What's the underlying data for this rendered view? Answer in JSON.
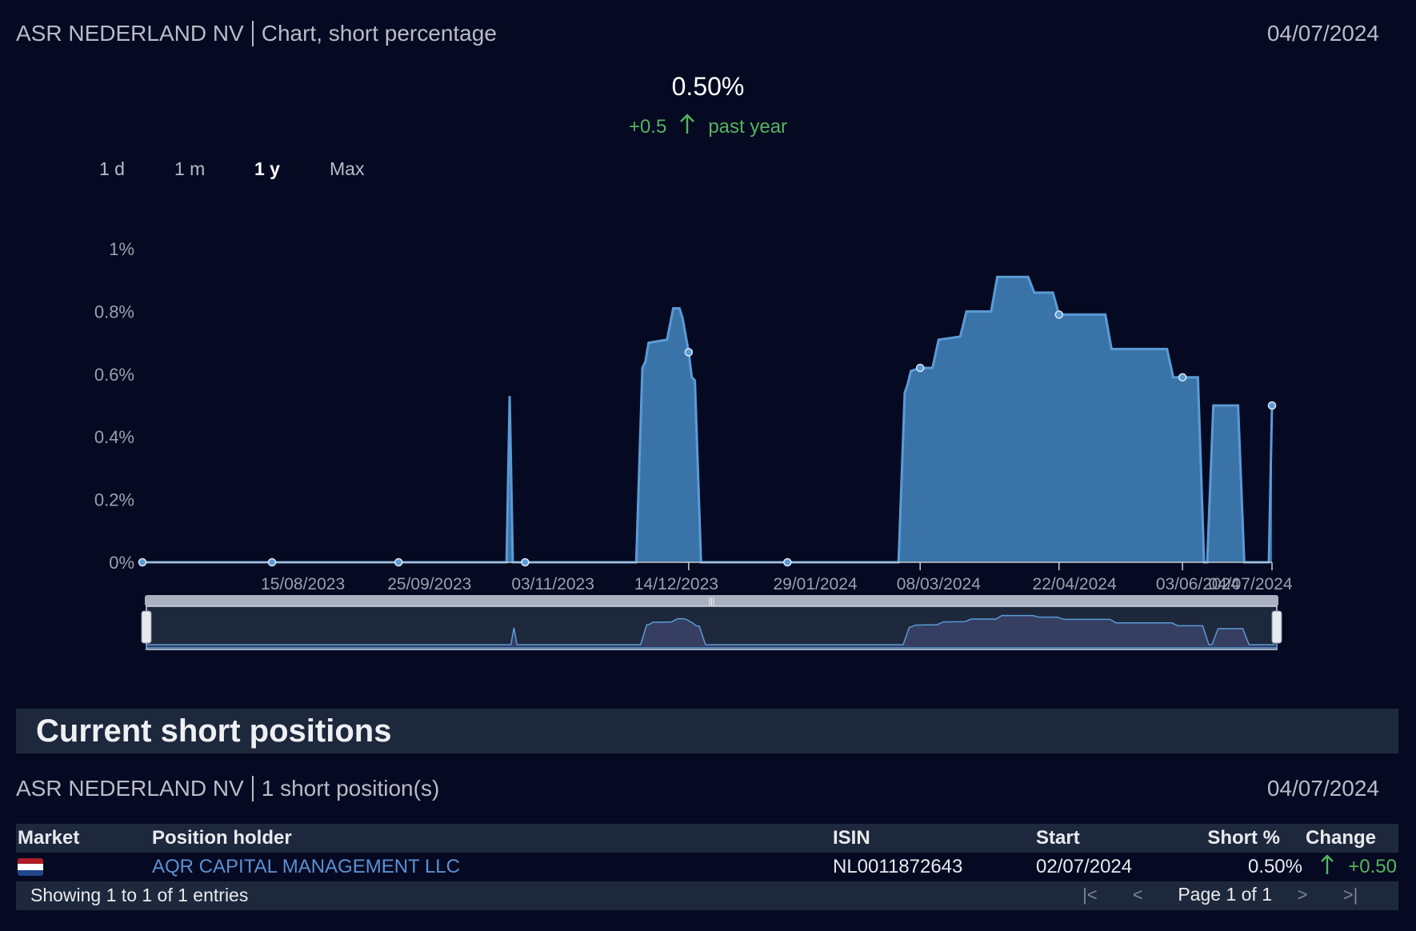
{
  "header": {
    "company": "ASR NEDERLAND NV",
    "subtitle": "Chart, short percentage",
    "date": "04/07/2024"
  },
  "kpi": {
    "value": "0.50%",
    "change": "+0.5",
    "period": "past year"
  },
  "ranges": [
    "1 d",
    "1 m",
    "1 y",
    "Max"
  ],
  "active_range": "1 y",
  "colors": {
    "background": "#050a22",
    "area_fill": "#3a73a8",
    "area_line": "#5b9bd5",
    "positive": "#56b35e",
    "navigator_fill": "#363e62",
    "band": "#1e283c"
  },
  "chart_data": {
    "type": "area",
    "xlabel": "",
    "ylabel": "",
    "ylim": [
      0,
      1
    ],
    "yticks": [
      "0%",
      "0.2%",
      "0.4%",
      "0.6%",
      "0.8%",
      "1%"
    ],
    "xticks": [
      "15/08/2023",
      "25/09/2023",
      "03/11/2023",
      "14/12/2023",
      "29/01/2024",
      "08/03/2024",
      "22/04/2024",
      "03/06/2024",
      "04/07/2024"
    ],
    "grid": false,
    "legend": "none",
    "navigator": true,
    "series": [
      {
        "values": [
          [
            "2023-07-04",
            0
          ],
          [
            "2023-10-30",
            0
          ],
          [
            "2023-10-31",
            0.53
          ],
          [
            "2023-11-01",
            0
          ],
          [
            "2023-12-11",
            0
          ],
          [
            "2023-12-13",
            0.62
          ],
          [
            "2023-12-14",
            0.64
          ],
          [
            "2023-12-15",
            0.7
          ],
          [
            "2023-12-21",
            0.71
          ],
          [
            "2023-12-23",
            0.81
          ],
          [
            "2023-12-25",
            0.81
          ],
          [
            "2023-12-26",
            0.78
          ],
          [
            "2023-12-28",
            0.67
          ],
          [
            "2023-12-29",
            0.59
          ],
          [
            "2023-12-30",
            0.58
          ],
          [
            "2024-01-01",
            0
          ],
          [
            "2024-03-05",
            0
          ],
          [
            "2024-03-07",
            0.54
          ],
          [
            "2024-03-08",
            0.57
          ],
          [
            "2024-03-09",
            0.61
          ],
          [
            "2024-03-12",
            0.62
          ],
          [
            "2024-03-16",
            0.62
          ],
          [
            "2024-03-18",
            0.71
          ],
          [
            "2024-03-25",
            0.72
          ],
          [
            "2024-03-27",
            0.8
          ],
          [
            "2024-04-04",
            0.8
          ],
          [
            "2024-04-06",
            0.91
          ],
          [
            "2024-04-16",
            0.91
          ],
          [
            "2024-04-18",
            0.86
          ],
          [
            "2024-04-24",
            0.86
          ],
          [
            "2024-04-26",
            0.79
          ],
          [
            "2024-05-11",
            0.79
          ],
          [
            "2024-05-13",
            0.68
          ],
          [
            "2024-05-31",
            0.68
          ],
          [
            "2024-06-02",
            0.59
          ],
          [
            "2024-06-10",
            0.59
          ],
          [
            "2024-06-12",
            0
          ],
          [
            "2024-06-13",
            0
          ],
          [
            "2024-06-15",
            0.5
          ],
          [
            "2024-06-23",
            0.5
          ],
          [
            "2024-06-25",
            0
          ],
          [
            "2024-07-03",
            0
          ],
          [
            "2024-07-04",
            0.5
          ]
        ]
      }
    ],
    "markers": [
      [
        "2023-07-04",
        0
      ],
      [
        "2023-08-15",
        0
      ],
      [
        "2023-09-25",
        0
      ],
      [
        "2023-11-05",
        0
      ],
      [
        "2023-12-28",
        0.67
      ],
      [
        "2024-01-29",
        0
      ],
      [
        "2024-03-12",
        0.62
      ],
      [
        "2024-04-26",
        0.79
      ],
      [
        "2024-06-05",
        0.59
      ],
      [
        "2024-07-04",
        0.5
      ]
    ]
  },
  "section": {
    "title": "Current short positions"
  },
  "positions_header": {
    "company": "ASR NEDERLAND NV",
    "count": "1 short position(s)",
    "date": "04/07/2024"
  },
  "table": {
    "columns": [
      "Market",
      "Position holder",
      "ISIN",
      "Start",
      "Short %",
      "Change"
    ],
    "rows": [
      {
        "market_flag": "netherlands-flag",
        "holder": "AQR CAPITAL MANAGEMENT LLC",
        "isin": "NL0011872643",
        "start": "02/07/2024",
        "short": "0.50%",
        "change": "+0.50"
      }
    ],
    "footer": "Showing 1 to 1 of 1 entries",
    "page": "Page 1 of 1"
  }
}
